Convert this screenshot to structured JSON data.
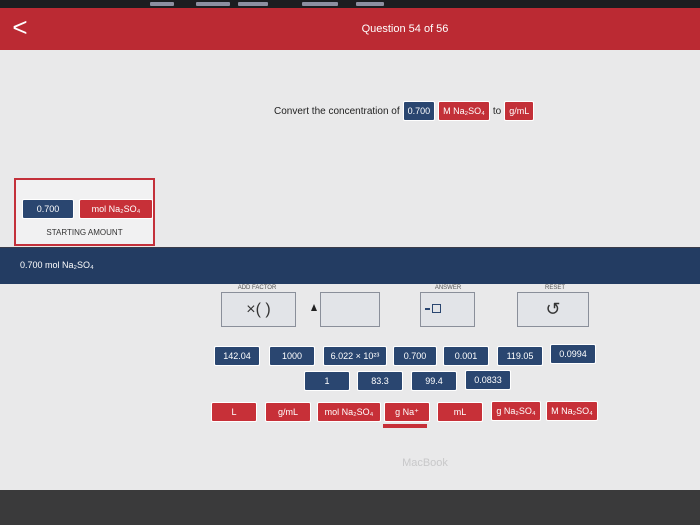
{
  "header": {
    "title": "Question 54 of 56",
    "back_glyph": "<"
  },
  "question": {
    "prefix": "Convert the concentration of",
    "value": "0.700",
    "unit": "M Na₂SO₄",
    "connector": "to",
    "target": "g/mL"
  },
  "starting": {
    "value": "0.700",
    "unit": "mol Na₂SO₄",
    "caption": "STARTING AMOUNT"
  },
  "result": {
    "text": "0.700 mol Na₂SO₄"
  },
  "workspace": {
    "add_factor_label": "ADD FACTOR",
    "answer_label": "ANSWER",
    "reset_label": "RESET",
    "factor_glyph": "×( )",
    "reset_glyph": "↺"
  },
  "number_tiles": [
    "142.04",
    "1000",
    "6.022 × 10²³",
    "0.700",
    "0.001",
    "119.05",
    "0.0994",
    "1",
    "83.3",
    "99.4",
    "0.0833"
  ],
  "unit_tiles": [
    "L",
    "g/mL",
    "mol Na₂SO₄",
    "g Na⁺",
    "mL",
    "g Na₂SO₄",
    "M Na₂SO₄"
  ],
  "colors": {
    "header_red": "#bb2a33",
    "tile_blue": "#2a4670",
    "tile_red": "#c73038",
    "result_bar": "#233c62"
  },
  "bezel_text": "MacBook"
}
